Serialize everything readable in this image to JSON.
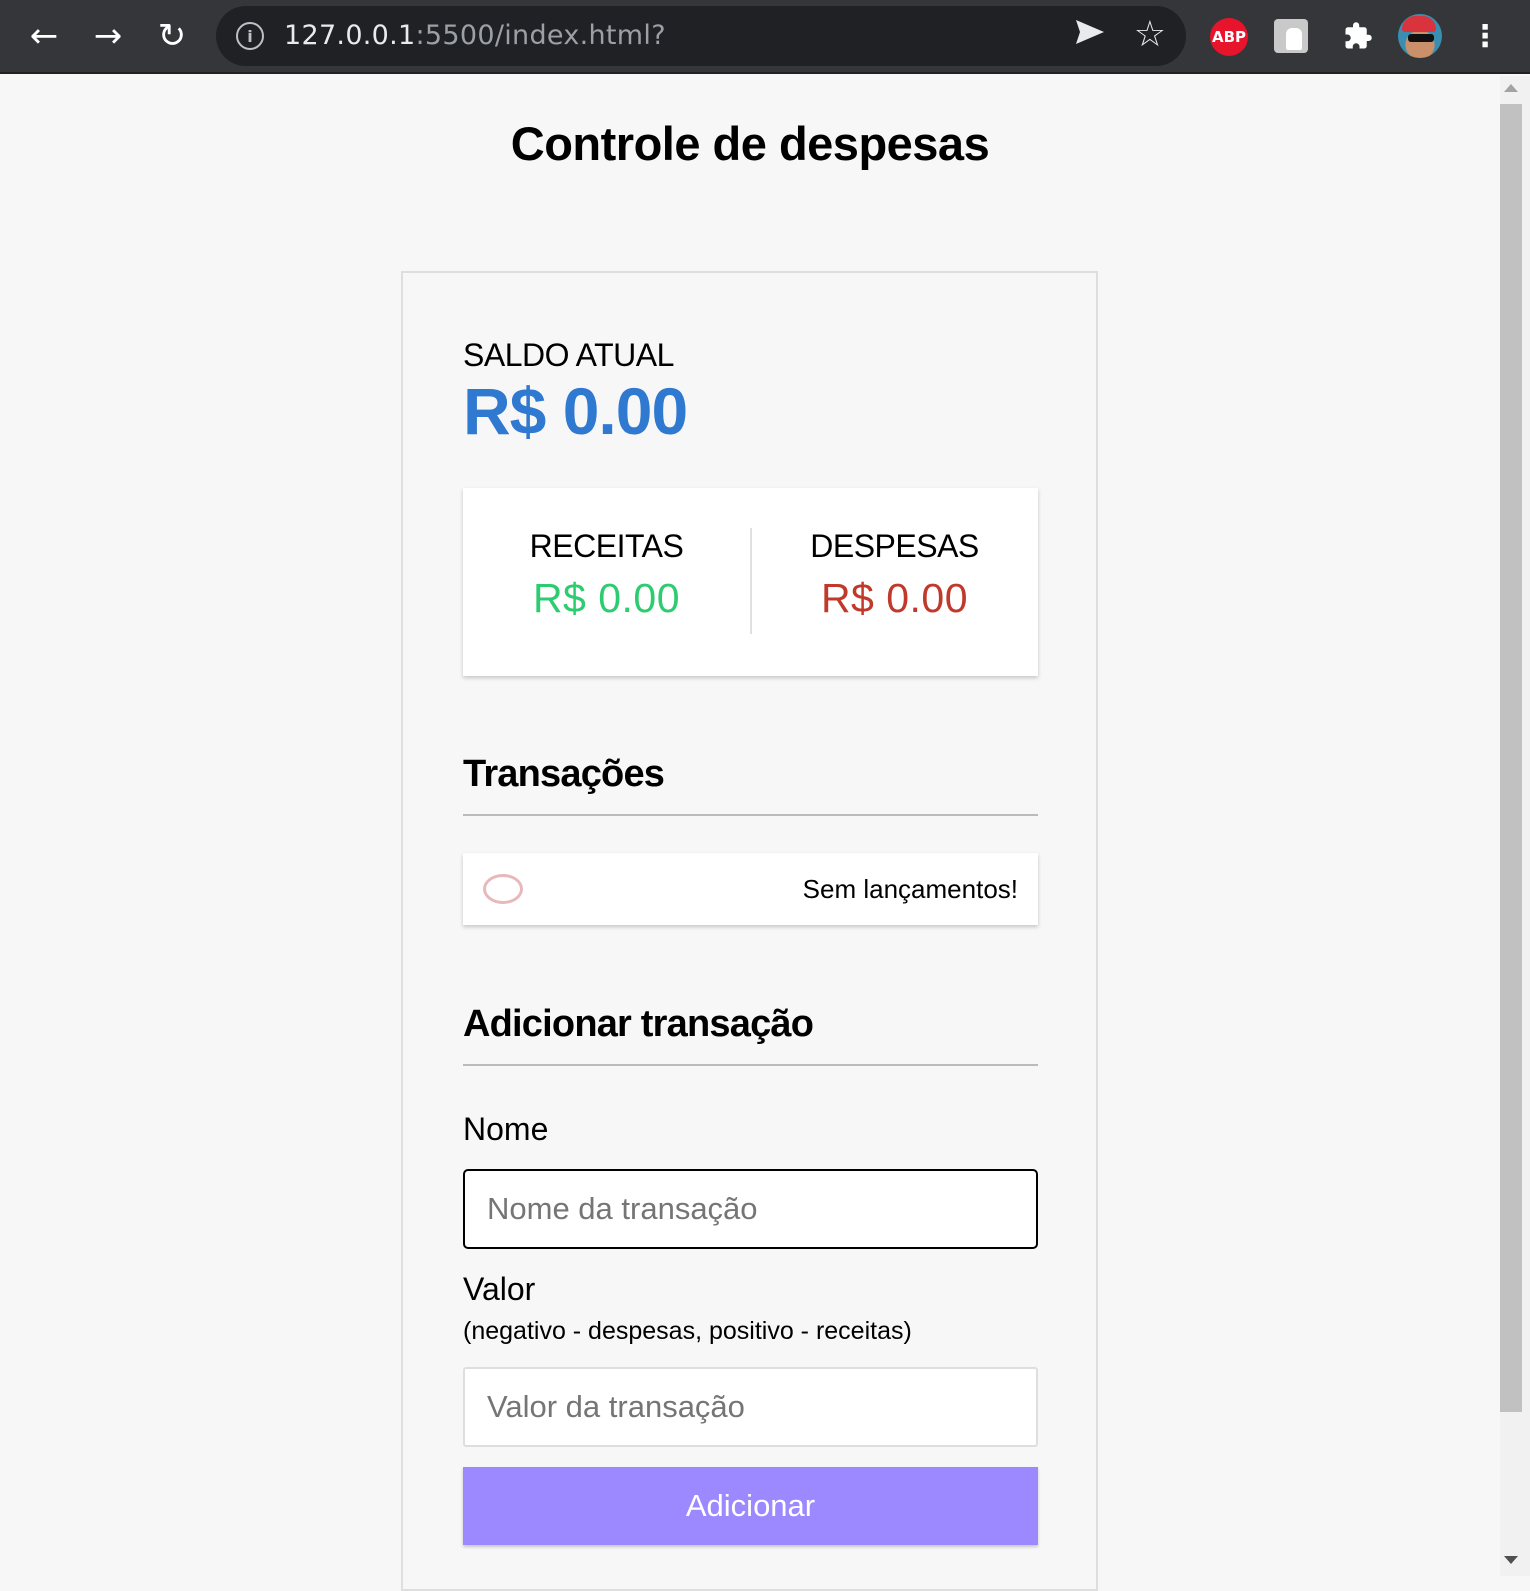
{
  "browser": {
    "url_host": "127.0.0.1",
    "url_path": ":5500/index.html?",
    "extensions": {
      "abp_label": "ABP"
    }
  },
  "page": {
    "title": "Controle de despesas",
    "balance": {
      "label": "SALDO ATUAL",
      "value": "R$ 0.00",
      "color": "#2f79d0"
    },
    "summary": {
      "income_label": "RECEITAS",
      "income_value": "R$ 0.00",
      "income_color": "#2ecc71",
      "expense_label": "DESPESAS",
      "expense_value": "R$ 0.00",
      "expense_color": "#c0392b"
    },
    "transactions": {
      "heading": "Transações",
      "items": [
        {
          "text": "Sem lançamentos!"
        }
      ]
    },
    "form": {
      "heading": "Adicionar transação",
      "name_label": "Nome",
      "name_placeholder": "Nome da transação",
      "name_value": "",
      "amount_label": "Valor",
      "amount_hint": "(negativo - despesas, positivo - receitas)",
      "amount_placeholder": "Valor da transação",
      "amount_value": "",
      "submit_label": "Adicionar",
      "submit_color": "#9c88ff"
    }
  }
}
